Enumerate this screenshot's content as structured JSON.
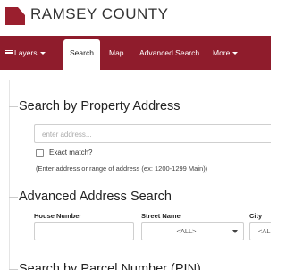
{
  "header": {
    "brand": "RAMSEY COUNTY"
  },
  "nav": {
    "items": [
      "Layers",
      "Search",
      "Map",
      "Advanced Search",
      "More"
    ],
    "active": "Search",
    "color": "#8f1c2c"
  },
  "property_search": {
    "title": "Search by Property Address",
    "placeholder": "enter address...",
    "exact_match_label": "Exact match?",
    "exact_match_checked": false,
    "hint": "(Enter address or range of address (ex: 1200-1299 Main))"
  },
  "advanced_search": {
    "title": "Advanced Address Search",
    "house_number_label": "House Number",
    "street_name_label": "Street Name",
    "street_name_value": "<ALL>",
    "city_label": "City",
    "city_value": "<ALL"
  },
  "pin_search": {
    "title": "Search by Parcel Number (PIN)"
  }
}
